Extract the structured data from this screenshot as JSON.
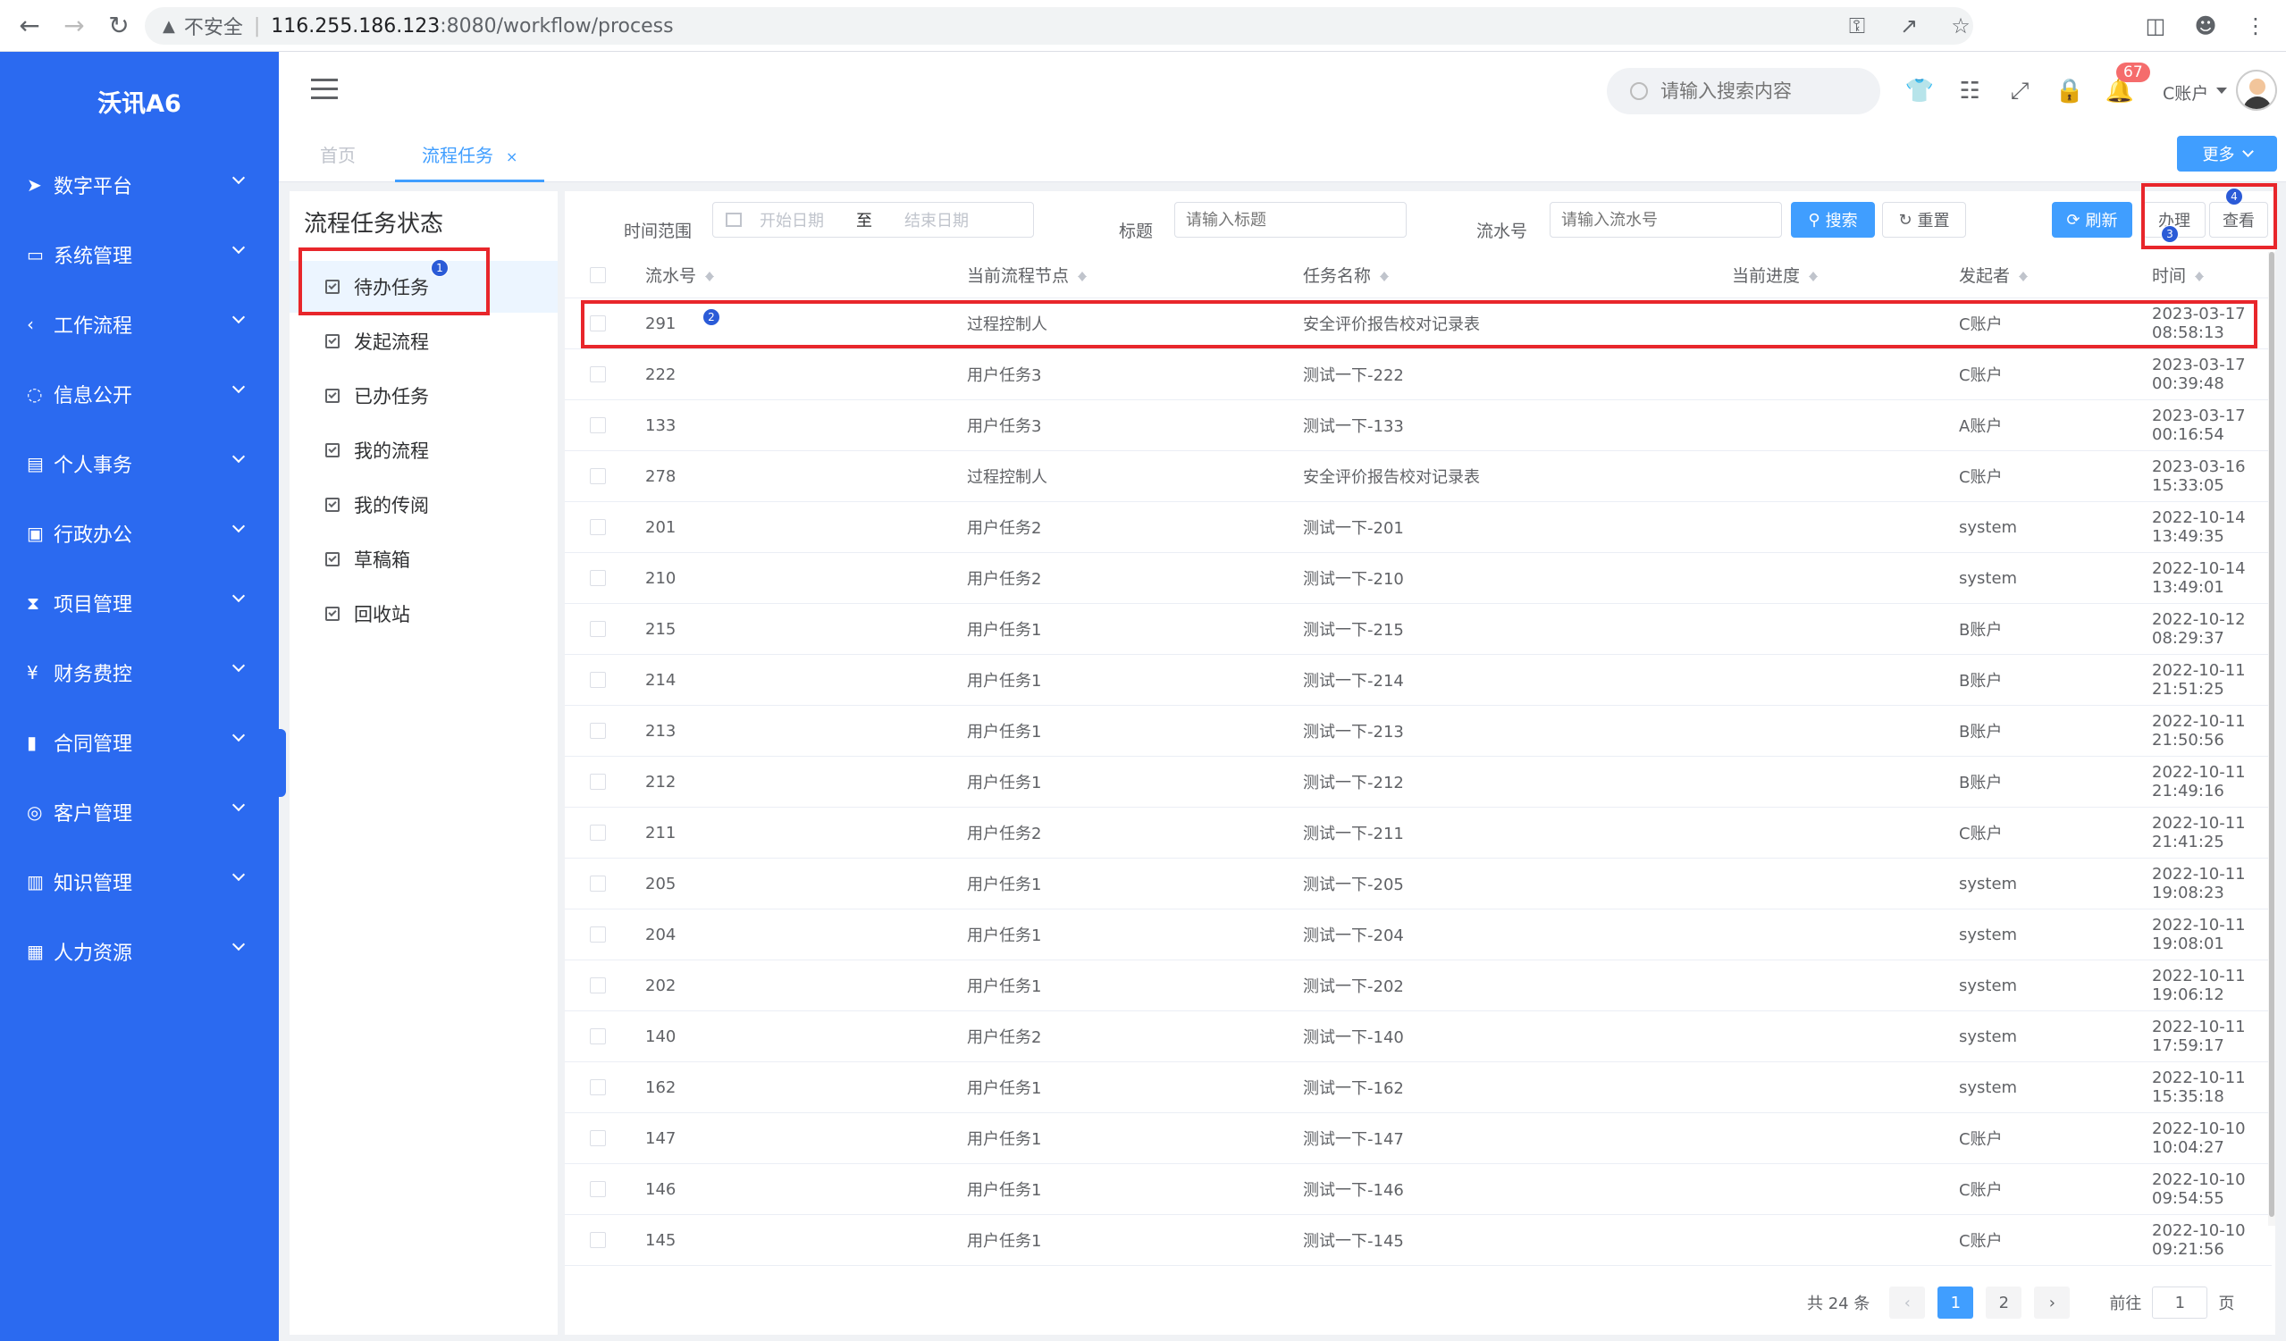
{
  "browser": {
    "security": "不安全",
    "url_host": "116.255.186.123",
    "url_path": ":8080/workflow/process"
  },
  "sidebar": {
    "brand": "沃讯A6",
    "items": [
      {
        "label": "数字平台",
        "icon": "send-icon"
      },
      {
        "label": "系统管理",
        "icon": "monitor-icon"
      },
      {
        "label": "工作流程",
        "icon": "share-icon"
      },
      {
        "label": "信息公开",
        "icon": "chat-icon"
      },
      {
        "label": "个人事务",
        "icon": "id-card-icon"
      },
      {
        "label": "行政办公",
        "icon": "briefcase-icon"
      },
      {
        "label": "项目管理",
        "icon": "hourglass-icon"
      },
      {
        "label": "财务费控",
        "icon": "yen-icon"
      },
      {
        "label": "合同管理",
        "icon": "file-icon"
      },
      {
        "label": "客户管理",
        "icon": "handshake-icon"
      },
      {
        "label": "知识管理",
        "icon": "book-icon"
      },
      {
        "label": "人力资源",
        "icon": "person-card-icon"
      }
    ]
  },
  "header": {
    "search_placeholder": "请输入搜索内容",
    "notification_count": "67",
    "user_name": "C账户"
  },
  "tabs": {
    "home": "首页",
    "current": "流程任务",
    "close": "×",
    "more": "更多"
  },
  "status_panel": {
    "title": "流程任务状态",
    "items": [
      "待办任务",
      "发起流程",
      "已办任务",
      "我的流程",
      "我的传阅",
      "草稿箱",
      "回收站"
    ]
  },
  "filters": {
    "time_range_label": "时间范围",
    "start_placeholder": "开始日期",
    "to": "至",
    "end_placeholder": "结束日期",
    "title_label": "标题",
    "title_placeholder": "请输入标题",
    "serial_label": "流水号",
    "serial_placeholder": "请输入流水号",
    "search": "搜索",
    "reset": "重置",
    "refresh": "刷新",
    "handle": "办理",
    "view": "查看"
  },
  "table": {
    "columns": [
      "流水号",
      "当前流程节点",
      "任务名称",
      "当前进度",
      "发起者",
      "时间"
    ],
    "rows": [
      {
        "id": "291",
        "node": "过程控制人",
        "name": "安全评价报告校对记录表",
        "progress": "",
        "initiator": "C账户",
        "time": "2023-03-17 08:58:13"
      },
      {
        "id": "222",
        "node": "用户任务3",
        "name": "测试一下-222",
        "progress": "",
        "initiator": "C账户",
        "time": "2023-03-17 00:39:48"
      },
      {
        "id": "133",
        "node": "用户任务3",
        "name": "测试一下-133",
        "progress": "",
        "initiator": "A账户",
        "time": "2023-03-17 00:16:54"
      },
      {
        "id": "278",
        "node": "过程控制人",
        "name": "安全评价报告校对记录表",
        "progress": "",
        "initiator": "C账户",
        "time": "2023-03-16 15:33:05"
      },
      {
        "id": "201",
        "node": "用户任务2",
        "name": "测试一下-201",
        "progress": "",
        "initiator": "system",
        "time": "2022-10-14 13:49:35"
      },
      {
        "id": "210",
        "node": "用户任务2",
        "name": "测试一下-210",
        "progress": "",
        "initiator": "system",
        "time": "2022-10-14 13:49:01"
      },
      {
        "id": "215",
        "node": "用户任务1",
        "name": "测试一下-215",
        "progress": "",
        "initiator": "B账户",
        "time": "2022-10-12 08:29:37"
      },
      {
        "id": "214",
        "node": "用户任务1",
        "name": "测试一下-214",
        "progress": "",
        "initiator": "B账户",
        "time": "2022-10-11 21:51:25"
      },
      {
        "id": "213",
        "node": "用户任务1",
        "name": "测试一下-213",
        "progress": "",
        "initiator": "B账户",
        "time": "2022-10-11 21:50:56"
      },
      {
        "id": "212",
        "node": "用户任务1",
        "name": "测试一下-212",
        "progress": "",
        "initiator": "B账户",
        "time": "2022-10-11 21:49:16"
      },
      {
        "id": "211",
        "node": "用户任务2",
        "name": "测试一下-211",
        "progress": "",
        "initiator": "C账户",
        "time": "2022-10-11 21:41:25"
      },
      {
        "id": "205",
        "node": "用户任务1",
        "name": "测试一下-205",
        "progress": "",
        "initiator": "system",
        "time": "2022-10-11 19:08:23"
      },
      {
        "id": "204",
        "node": "用户任务1",
        "name": "测试一下-204",
        "progress": "",
        "initiator": "system",
        "time": "2022-10-11 19:08:01"
      },
      {
        "id": "202",
        "node": "用户任务1",
        "name": "测试一下-202",
        "progress": "",
        "initiator": "system",
        "time": "2022-10-11 19:06:12"
      },
      {
        "id": "140",
        "node": "用户任务2",
        "name": "测试一下-140",
        "progress": "",
        "initiator": "system",
        "time": "2022-10-11 17:59:17"
      },
      {
        "id": "162",
        "node": "用户任务1",
        "name": "测试一下-162",
        "progress": "",
        "initiator": "system",
        "time": "2022-10-11 15:35:18"
      },
      {
        "id": "147",
        "node": "用户任务1",
        "name": "测试一下-147",
        "progress": "",
        "initiator": "C账户",
        "time": "2022-10-10 10:04:27"
      },
      {
        "id": "146",
        "node": "用户任务1",
        "name": "测试一下-146",
        "progress": "",
        "initiator": "C账户",
        "time": "2022-10-10 09:54:55"
      },
      {
        "id": "145",
        "node": "用户任务1",
        "name": "测试一下-145",
        "progress": "",
        "initiator": "C账户",
        "time": "2022-10-10 09:21:56"
      }
    ]
  },
  "pagination": {
    "total": "共 24 条",
    "pages": [
      "1",
      "2"
    ],
    "goto": "前往",
    "goto_value": "1",
    "page_unit": "页"
  },
  "annotations": {
    "markers": [
      "1",
      "2",
      "3",
      "4"
    ],
    "box_color": "#e8262b",
    "marker_color": "#2b5bd7"
  },
  "colors": {
    "sidebar": "#2b6af0",
    "primary": "#409eff"
  }
}
